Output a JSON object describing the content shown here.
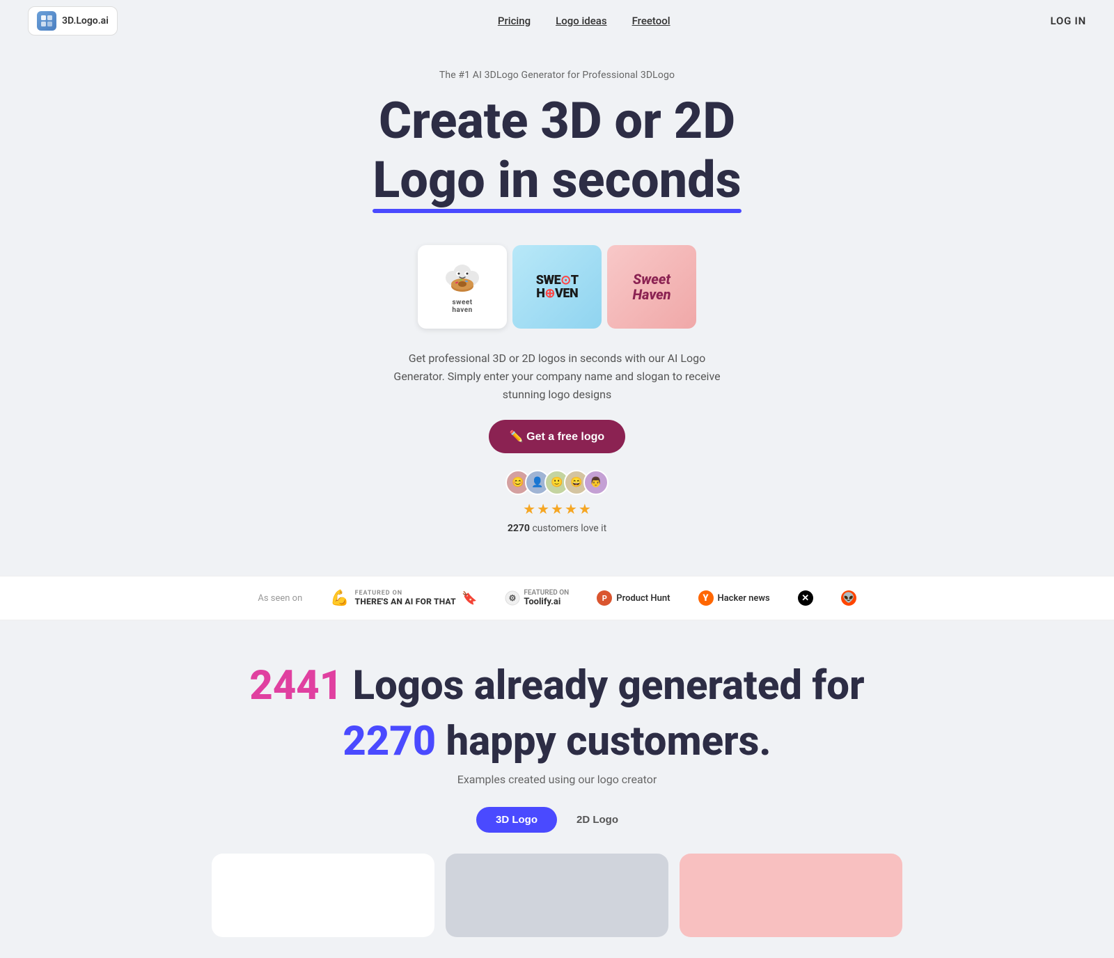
{
  "navbar": {
    "logo_text": "3D.Logo.ai",
    "nav_links": [
      {
        "label": "Pricing",
        "id": "pricing"
      },
      {
        "label": "Logo ideas",
        "id": "logo-ideas"
      },
      {
        "label": "Freetool",
        "id": "freetool"
      }
    ],
    "login_label": "LOG IN"
  },
  "hero": {
    "tagline": "The #1 AI 3DLogo Generator for Professional 3DLogo",
    "title_line1": "Create 3D or 2D",
    "title_line2": "Logo in seconds",
    "description": "Get professional 3D or 2D logos in seconds with our AI Logo Generator. Simply enter your company name and slogan to receive stunning logo designs",
    "cta_label": "✏️ Get a free logo",
    "review_count": "2270",
    "review_text": "customers love it",
    "stars": 4.5
  },
  "as_seen_on": {
    "label": "As seen on",
    "badges": [
      {
        "type": "theres-ai",
        "featured_label": "FEATURED ON",
        "name": "THERE'S AN AI FOR THAT"
      },
      {
        "type": "toolify",
        "featured_label": "FEATURED ON",
        "name": "Toolify.ai"
      },
      {
        "type": "product-hunt",
        "icon_letter": "P",
        "name": "Product Hunt"
      },
      {
        "type": "hacker-news",
        "icon_letter": "Y",
        "name": "Hacker news"
      },
      {
        "type": "x",
        "icon": "✕"
      },
      {
        "type": "reddit",
        "icon": "👽"
      }
    ]
  },
  "stats": {
    "logo_count": "2441",
    "logos_label": "Logos already generated for",
    "customer_count": "2270",
    "customers_label": "happy customers.",
    "examples_label": "Examples created using our logo creator",
    "tabs": [
      {
        "label": "3D Logo",
        "active": true
      },
      {
        "label": "2D Logo",
        "active": false
      }
    ]
  }
}
